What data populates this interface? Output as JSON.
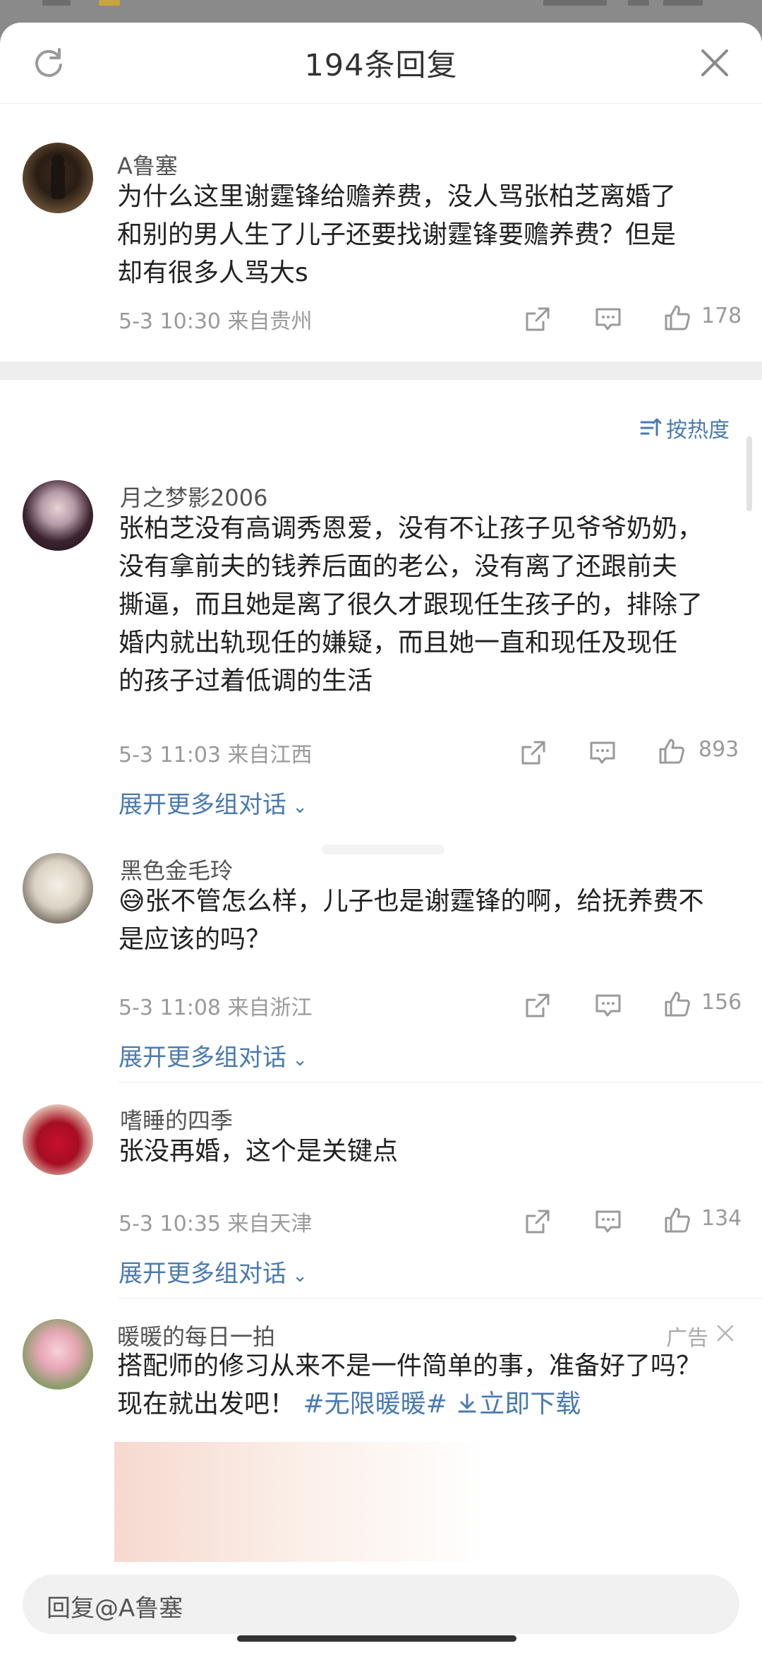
{
  "header": {
    "title": "194条回复"
  },
  "root_comment": {
    "username": "A鲁塞",
    "text": "为什么这里谢霆锋给赡养费，没人骂张柏芝离婚了和别的男人生了儿子还要找谢霆锋要赡养费？但是却有很多人骂大s",
    "lines": [
      "为什么这里谢霆锋给赡养费，没人骂张柏芝离婚了",
      "和别的男人生了儿子还要找谢霆锋要赡养费？但是",
      "却有很多人骂大s"
    ],
    "meta": "5-3 10:30  来自贵州",
    "likes": "178"
  },
  "sort_label": "按热度",
  "replies": [
    {
      "username": "月之梦影2006",
      "lines": [
        "张柏芝没有高调秀恩爱，没有不让孩子见爷爷奶奶，",
        "没有拿前夫的钱养后面的老公，没有离了还跟前夫",
        "撕逼，而且她是离了很久才跟现任生孩子的，排除了",
        "婚内就出轨现任的嫌疑，而且她一直和现任及现任",
        "的孩子过着低调的生活"
      ],
      "meta": "5-3 11:03  来自江西",
      "likes": "893",
      "expand": "展开更多组对话"
    },
    {
      "username": "黑色金毛玲",
      "lines": [
        "😅张不管怎么样，儿子也是谢霆锋的啊，给抚养费不",
        "是应该的吗？"
      ],
      "meta": "5-3 11:08  来自浙江",
      "likes": "156",
      "expand": "展开更多组对话"
    },
    {
      "username": "嗜睡的四季",
      "lines": [
        "张没再婚，这个是关键点"
      ],
      "meta": "5-3 10:35  来自天津",
      "likes": "134",
      "expand": "展开更多组对话"
    }
  ],
  "ad": {
    "username": "暖暖的每日一拍",
    "tag": "广告",
    "line1": "搭配师的修习从来不是一件简单的事，准备好了吗？",
    "line2_text": "现在就出发吧！",
    "hashtag": "#无限暖暖#",
    "download": "立即下载"
  },
  "reply_bar": {
    "placeholder": "回复@A鲁塞"
  },
  "colors": {
    "link": "#4a7ab0",
    "meta": "#9a9a9a",
    "background": "#ffffff"
  }
}
